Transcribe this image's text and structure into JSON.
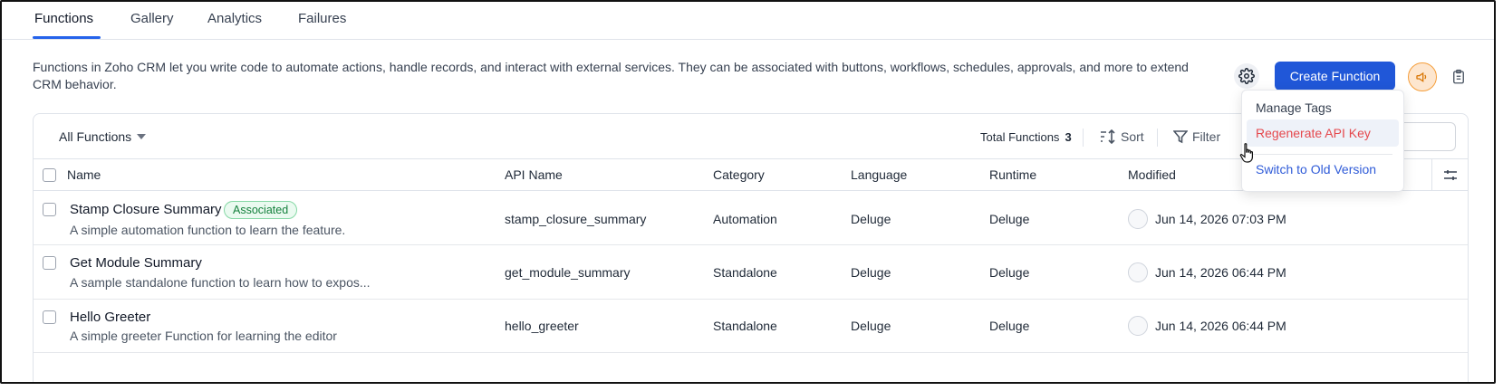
{
  "tabs": [
    {
      "label": "Functions",
      "active": true
    },
    {
      "label": "Gallery",
      "active": false
    },
    {
      "label": "Analytics",
      "active": false
    },
    {
      "label": "Failures",
      "active": false
    }
  ],
  "description": "Functions in Zoho CRM let you write code to automate actions, handle records, and interact with external services. They can be associated with buttons, workflows, schedules, approvals, and more to extend CRM behavior.",
  "header": {
    "settings_icon": "gear-icon",
    "create_label": "Create Function",
    "announce_icon": "megaphone-icon",
    "doc_icon": "clipboard-icon"
  },
  "toolbar": {
    "filter_view": "All Functions",
    "total_label": "Total Functions",
    "total_count": "3",
    "sort_label": "Sort",
    "filter_label": "Filter"
  },
  "columns": [
    "Name",
    "API Name",
    "Category",
    "Language",
    "Runtime",
    "Modified"
  ],
  "rows": [
    {
      "name": "Stamp Closure Summary",
      "badge": "Associated",
      "desc": "A simple automation function to learn the feature.",
      "api": "stamp_closure_summary",
      "category": "Automation",
      "language": "Deluge",
      "runtime": "Deluge",
      "modified": "Jun 14, 2026 07:03 PM"
    },
    {
      "name": "Get Module Summary",
      "badge": "",
      "desc": "A sample standalone function to learn how to expos...",
      "api": "get_module_summary",
      "category": "Standalone",
      "language": "Deluge",
      "runtime": "Deluge",
      "modified": "Jun 14, 2026 06:44 PM"
    },
    {
      "name": "Hello Greeter",
      "badge": "",
      "desc": "A simple greeter Function for learning the editor",
      "api": "hello_greeter",
      "category": "Standalone",
      "language": "Deluge",
      "runtime": "Deluge",
      "modified": "Jun 14, 2026 06:44 PM"
    }
  ],
  "menu": {
    "manage_tags": "Manage Tags",
    "regenerate": "Regenerate API Key",
    "switch": "Switch to Old Version"
  },
  "colors": {
    "accent": "#2057d8",
    "danger": "#e5484d",
    "link": "#2f5bd8",
    "badge_green": "#15803d"
  }
}
